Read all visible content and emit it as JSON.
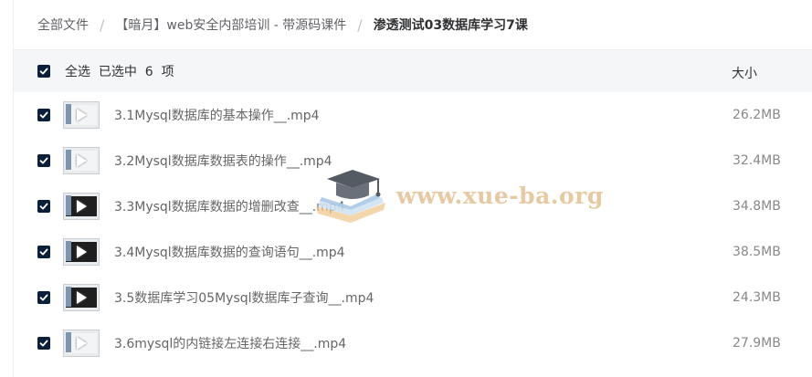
{
  "breadcrumb": {
    "items": [
      "全部文件",
      "【暗月】web安全内部培训 - 带源码课件",
      "渗透测试03数据库学习7课"
    ],
    "separator": "/"
  },
  "list_header": {
    "select_all_label": "全选  已选中  6  项",
    "size_label": "大小",
    "checked": true
  },
  "files": [
    {
      "name": "3.1Mysql数据库的基本操作__.mp4",
      "size": "26.2MB",
      "checked": true,
      "thumb_icon": "video-thumbnail-icon"
    },
    {
      "name": "3.2Mysql数据库数据表的操作__.mp4",
      "size": "32.4MB",
      "checked": true,
      "thumb_icon": "video-thumbnail-icon"
    },
    {
      "name": "3.3Mysql数据库数据的增删改查__.mp4",
      "size": "34.8MB",
      "checked": true,
      "thumb_icon": "video-thumbnail-icon"
    },
    {
      "name": "3.4Mysql数据库数据的查询语句__.mp4",
      "size": "38.5MB",
      "checked": true,
      "thumb_icon": "video-thumbnail-icon"
    },
    {
      "name": "3.5数据库学习05Mysql数据库子查询__.mp4",
      "size": "24.3MB",
      "checked": true,
      "thumb_icon": "video-thumbnail-icon"
    },
    {
      "name": "3.6mysql的内链接左连接右连接__.mp4",
      "size": "27.9MB",
      "checked": true,
      "thumb_icon": "video-thumbnail-icon"
    }
  ],
  "watermark": {
    "text": "www.xue-ba.org",
    "icon": "graduation-cap-book-icon"
  },
  "colors": {
    "checkbox": "#0b1f3a",
    "header_bg": "#f5f6f8",
    "watermark": "#e7c9a2"
  }
}
